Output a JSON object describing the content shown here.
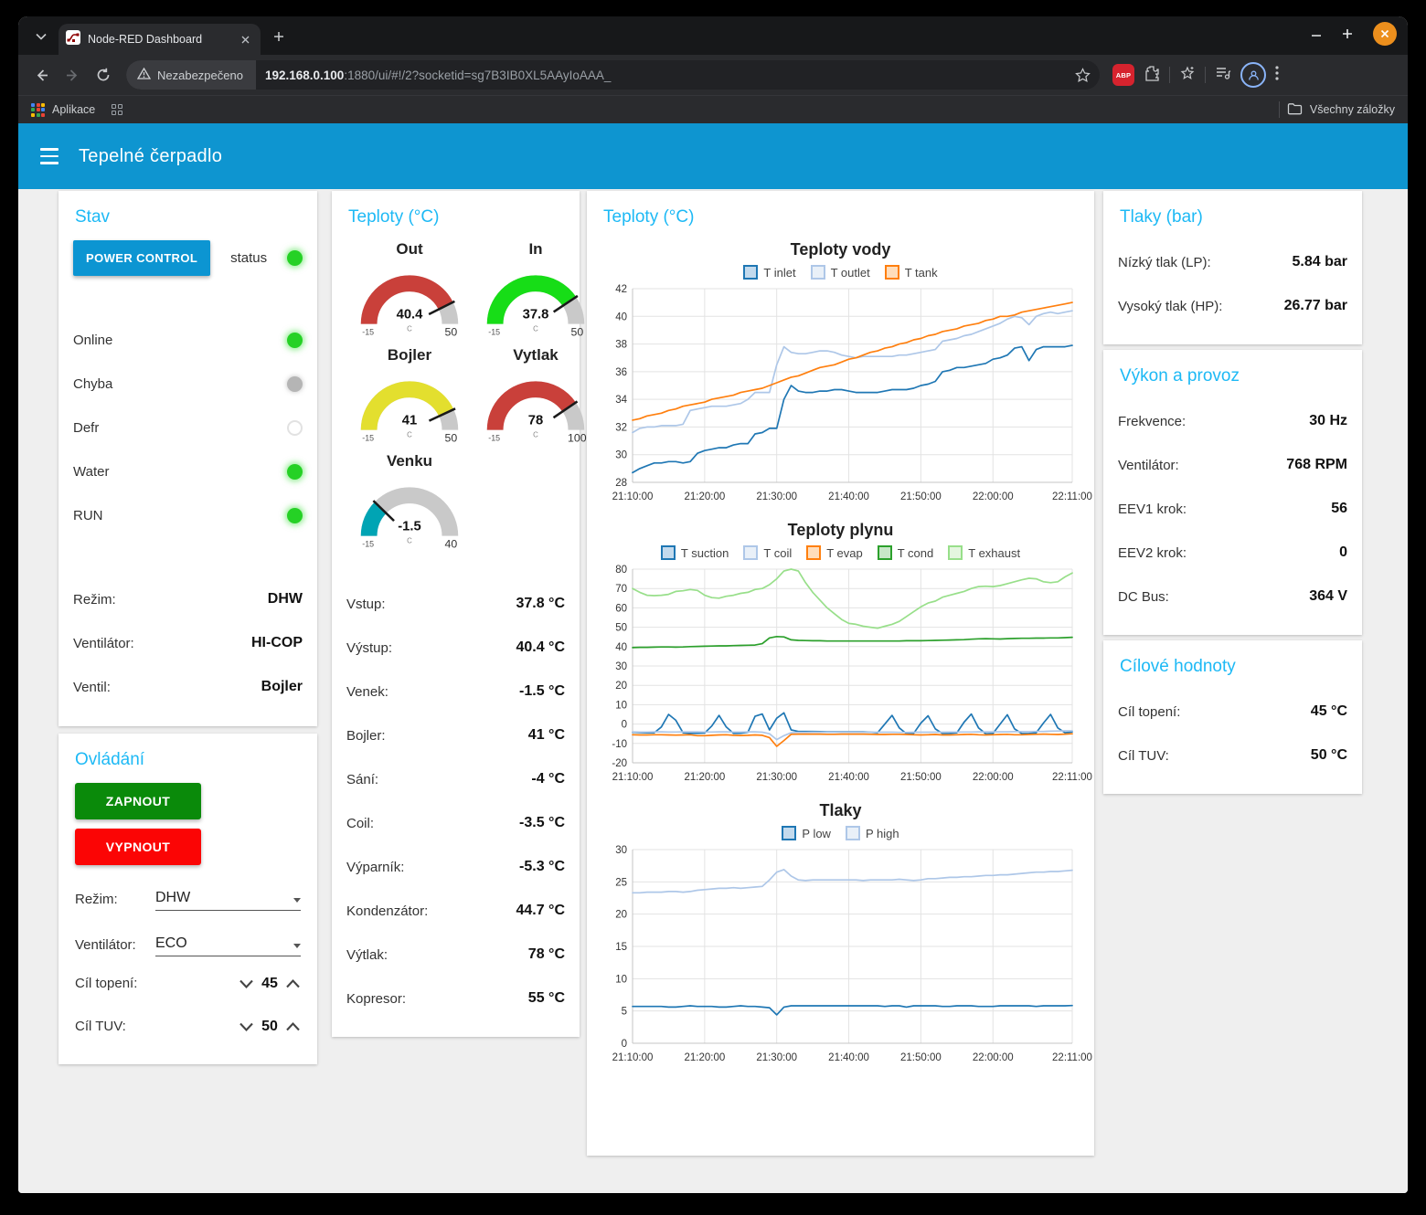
{
  "browser": {
    "tab_title": "Node-RED Dashboard",
    "security_label": "Nezabezpečeno",
    "url_host": "192.168.0.100",
    "url_rest": ":1880/ui/#!/2?socketid=sg7B3IB0XL5AAyIoAAA_",
    "abp_label": "ABP",
    "bookmarks_left": "Aplikace",
    "bookmarks_right": "Všechny záložky"
  },
  "header": {
    "title": "Tepelné čerpadlo"
  },
  "stav": {
    "title": "Stav",
    "power_button": "POWER CONTROL",
    "status_label": "status",
    "leds": [
      {
        "label": "Online",
        "state": "on"
      },
      {
        "label": "Chyba",
        "state": "gray"
      },
      {
        "label": "Defr",
        "state": "off"
      },
      {
        "label": "Water",
        "state": "on"
      },
      {
        "label": "RUN",
        "state": "on"
      }
    ],
    "info": [
      {
        "label": "Režim:",
        "value": "DHW"
      },
      {
        "label": "Ventilátor:",
        "value": "HI-COP"
      },
      {
        "label": "Ventil:",
        "value": "Bojler"
      }
    ]
  },
  "ovladani": {
    "title": "Ovládání",
    "on_button": "ZAPNOUT",
    "off_button": "VYPNOUT",
    "selects": [
      {
        "label": "Režim:",
        "value": "DHW"
      },
      {
        "label": "Ventilátor:",
        "value": "ECO"
      }
    ],
    "steppers": [
      {
        "label": "Cíl topení:",
        "value": "45"
      },
      {
        "label": "Cíl TUV:",
        "value": "50"
      }
    ]
  },
  "teploty": {
    "title": "Teploty (°C)",
    "gauges": [
      {
        "label": "Out",
        "value": "40.4",
        "num": 40.4,
        "min": -15,
        "max": 50,
        "unit": "C",
        "color": "#c9403a"
      },
      {
        "label": "In",
        "value": "37.8",
        "num": 37.8,
        "min": -15,
        "max": 50,
        "unit": "C",
        "color": "#17dd17"
      },
      {
        "label": "Bojler",
        "value": "41",
        "num": 41,
        "min": -15,
        "max": 50,
        "unit": "C",
        "color": "#e3df2e"
      },
      {
        "label": "Vytlak",
        "value": "78",
        "num": 78,
        "min": -15,
        "max": 100,
        "unit": "C",
        "color": "#c9403a"
      },
      {
        "label": "Venku",
        "value": "-1.5",
        "num": -1.5,
        "min": -15,
        "max": 40,
        "unit": "C",
        "color": "#00a4b4"
      }
    ],
    "values": [
      {
        "label": "Vstup:",
        "value": "37.8 °C"
      },
      {
        "label": "Výstup:",
        "value": "40.4 °C"
      },
      {
        "label": "Venek:",
        "value": "-1.5 °C"
      },
      {
        "label": "Bojler:",
        "value": "41 °C"
      },
      {
        "label": "Sání:",
        "value": "-4 °C"
      },
      {
        "label": "Coil:",
        "value": "-3.5 °C"
      },
      {
        "label": "Výparník:",
        "value": "-5.3 °C"
      },
      {
        "label": "Kondenzátor:",
        "value": "44.7 °C"
      },
      {
        "label": "Výtlak:",
        "value": "78 °C"
      },
      {
        "label": "Kopresor:",
        "value": "55 °C"
      }
    ]
  },
  "charts_card": {
    "title": "Teploty (°C)"
  },
  "chart_data": [
    {
      "type": "line",
      "title": "Teploty vody",
      "ylim": [
        28,
        42
      ],
      "y_step": 2,
      "x_total": 61,
      "x_ticks": [
        {
          "m": 0,
          "label": "21:10:00"
        },
        {
          "m": 10,
          "label": "21:20:00"
        },
        {
          "m": 20,
          "label": "21:30:00"
        },
        {
          "m": 30,
          "label": "21:40:00"
        },
        {
          "m": 40,
          "label": "21:50:00"
        },
        {
          "m": 50,
          "label": "22:00:00"
        },
        {
          "m": 61,
          "label": "22:11:00"
        }
      ],
      "series": [
        {
          "name": "T inlet",
          "color": "#1f77b4",
          "fill": "#c3daed",
          "values": [
            28.7,
            29.0,
            29.2,
            29.4,
            29.4,
            29.5,
            29.5,
            29.4,
            29.5,
            30.1,
            30.3,
            30.4,
            30.5,
            30.5,
            30.7,
            30.8,
            30.8,
            31.5,
            31.6,
            31.9,
            31.9,
            34.0,
            35.0,
            34.6,
            34.5,
            34.5,
            34.6,
            34.6,
            34.7,
            34.7,
            34.6,
            34.5,
            34.5,
            34.5,
            34.5,
            34.6,
            34.7,
            34.7,
            34.7,
            34.8,
            35.0,
            35.1,
            35.3,
            36.0,
            36.1,
            36.3,
            36.3,
            36.4,
            36.5,
            36.6,
            36.9,
            37.0,
            37.2,
            37.7,
            37.8,
            36.8,
            37.6,
            37.8,
            37.8,
            37.8,
            37.8,
            37.9
          ]
        },
        {
          "name": "T outlet",
          "color": "#aec7e8",
          "fill": "#e9f0f8",
          "values": [
            31.6,
            31.9,
            32.0,
            32.0,
            32.1,
            32.1,
            32.1,
            32.2,
            33.2,
            33.3,
            33.4,
            33.5,
            33.5,
            33.5,
            33.6,
            33.7,
            34.0,
            34.5,
            34.5,
            34.5,
            36.5,
            37.8,
            37.4,
            37.3,
            37.3,
            37.4,
            37.5,
            37.5,
            37.4,
            37.2,
            37.1,
            37.0,
            37.1,
            37.1,
            37.1,
            37.1,
            37.1,
            37.2,
            37.2,
            37.3,
            37.4,
            37.5,
            37.6,
            38.2,
            38.3,
            38.4,
            38.6,
            38.7,
            38.9,
            39.1,
            39.3,
            39.5,
            39.8,
            40.0,
            39.9,
            39.4,
            40.0,
            40.2,
            40.3,
            40.2,
            40.3,
            40.4
          ]
        },
        {
          "name": "T tank",
          "color": "#ff7f0e",
          "fill": "#ffddbb",
          "values": [
            32.5,
            32.6,
            32.8,
            32.9,
            33.0,
            33.2,
            33.3,
            33.5,
            33.6,
            33.7,
            33.8,
            34.0,
            34.1,
            34.2,
            34.3,
            34.5,
            34.6,
            34.7,
            34.8,
            35.0,
            35.2,
            35.4,
            35.6,
            35.7,
            35.9,
            36.1,
            36.3,
            36.4,
            36.5,
            36.7,
            36.9,
            37.0,
            37.2,
            37.4,
            37.5,
            37.7,
            37.8,
            38.0,
            38.1,
            38.3,
            38.4,
            38.6,
            38.7,
            38.9,
            39.0,
            39.1,
            39.3,
            39.4,
            39.5,
            39.7,
            39.8,
            40.0,
            40.0,
            40.1,
            40.3,
            40.4,
            40.5,
            40.6,
            40.7,
            40.8,
            40.9,
            41.0
          ]
        }
      ]
    },
    {
      "type": "line",
      "title": "Teploty plynu",
      "ylim": [
        -20,
        80
      ],
      "y_step": 10,
      "x_total": 61,
      "x_ticks": [
        {
          "m": 0,
          "label": "21:10:00"
        },
        {
          "m": 10,
          "label": "21:20:00"
        },
        {
          "m": 20,
          "label": "21:30:00"
        },
        {
          "m": 30,
          "label": "21:40:00"
        },
        {
          "m": 40,
          "label": "21:50:00"
        },
        {
          "m": 50,
          "label": "22:00:00"
        },
        {
          "m": 61,
          "label": "22:11:00"
        }
      ],
      "series": [
        {
          "name": "T suction",
          "color": "#1f77b4",
          "fill": "#c3daed",
          "values": [
            -4.2,
            -4.4,
            -4.5,
            -4.5,
            -1.5,
            5.0,
            2.0,
            -4.5,
            -4.8,
            -4.7,
            -4.6,
            -1.0,
            4.5,
            -1.5,
            -4.8,
            -4.7,
            -4.2,
            4.0,
            5.2,
            -3.0,
            3.0,
            5.8,
            -3.0,
            -3.8,
            -3.8,
            -3.8,
            -3.9,
            -4.0,
            -4.0,
            -4.0,
            -4.0,
            -4.0,
            -4.0,
            -4.2,
            -4.5,
            0.0,
            4.5,
            -2.0,
            -5.0,
            -4.8,
            0.5,
            4.3,
            -2.5,
            -4.9,
            -4.8,
            -4.5,
            1.0,
            5.2,
            -2.0,
            -5.0,
            -4.8,
            0.0,
            4.8,
            -2.5,
            -4.9,
            -4.8,
            -4.5,
            0.5,
            5.0,
            -2.0,
            -4.5,
            -4.0
          ]
        },
        {
          "name": "T coil",
          "color": "#aec7e8",
          "fill": "#e9f0f8",
          "values": [
            -4.0,
            -4.1,
            -4.1,
            -4.0,
            -4.0,
            -4.1,
            -4.1,
            -4.0,
            -4.0,
            -4.0,
            -4.1,
            -4.1,
            -4.0,
            -4.0,
            -4.1,
            -4.1,
            -4.0,
            -4.0,
            -4.2,
            -5.0,
            -8.0,
            -6.0,
            -4.5,
            -4.3,
            -4.3,
            -4.2,
            -4.2,
            -4.2,
            -4.2,
            -4.2,
            -4.2,
            -4.2,
            -4.2,
            -4.2,
            -4.2,
            -4.2,
            -4.2,
            -4.3,
            -4.3,
            -4.2,
            -4.2,
            -4.2,
            -4.2,
            -4.2,
            -4.1,
            -4.1,
            -4.1,
            -4.1,
            -4.0,
            -4.0,
            -4.0,
            -4.0,
            -4.0,
            -3.9,
            -3.9,
            -3.9,
            -3.8,
            -3.8,
            -3.7,
            -3.6,
            -3.5,
            -3.5
          ]
        },
        {
          "name": "T evap",
          "color": "#ff7f0e",
          "fill": "#ffddbb",
          "values": [
            -5.5,
            -5.6,
            -5.6,
            -5.5,
            -5.5,
            -5.6,
            -5.7,
            -5.6,
            -5.5,
            -6.0,
            -6.0,
            -5.8,
            -5.6,
            -5.5,
            -5.8,
            -5.9,
            -5.8,
            -5.6,
            -5.8,
            -7.0,
            -11.5,
            -8.5,
            -5.3,
            -5.2,
            -5.2,
            -5.2,
            -5.2,
            -5.3,
            -5.3,
            -5.2,
            -5.2,
            -5.2,
            -5.2,
            -5.3,
            -5.4,
            -5.4,
            -5.3,
            -5.3,
            -5.4,
            -5.5,
            -5.6,
            -5.5,
            -5.4,
            -5.6,
            -5.6,
            -5.5,
            -5.4,
            -5.3,
            -5.5,
            -5.6,
            -5.5,
            -5.4,
            -5.3,
            -5.5,
            -5.5,
            -5.4,
            -5.3,
            -5.2,
            -5.3,
            -5.4,
            -5.2,
            -5.0
          ]
        },
        {
          "name": "T cond",
          "color": "#2ca02c",
          "fill": "#c8e7c8",
          "values": [
            39.5,
            39.6,
            39.6,
            39.7,
            39.8,
            39.8,
            39.7,
            39.8,
            40.0,
            40.1,
            40.2,
            40.3,
            40.4,
            40.4,
            40.5,
            40.6,
            40.7,
            40.8,
            41.5,
            44.5,
            45.2,
            45.0,
            43.5,
            43.2,
            43.1,
            43.0,
            43.0,
            42.9,
            42.9,
            42.9,
            42.9,
            42.9,
            42.9,
            42.9,
            42.9,
            42.9,
            42.9,
            42.9,
            43.0,
            43.0,
            43.0,
            43.1,
            43.2,
            43.3,
            43.4,
            43.5,
            43.6,
            43.8,
            44.0,
            44.1,
            44.0,
            43.9,
            44.1,
            44.2,
            44.3,
            44.3,
            44.4,
            44.4,
            44.5,
            44.5,
            44.6,
            44.8
          ]
        },
        {
          "name": "T exhaust",
          "color": "#98df8a",
          "fill": "#e4f6df",
          "values": [
            70,
            68,
            66.5,
            66.3,
            66.5,
            67,
            68.5,
            68.8,
            69.5,
            69,
            66.5,
            65.3,
            65,
            66,
            66.5,
            67.5,
            68,
            69.5,
            70,
            72,
            75,
            79,
            80,
            79,
            73,
            68,
            64,
            60,
            57,
            54,
            52,
            51.5,
            50.5,
            50,
            49.5,
            50.5,
            51.5,
            53,
            55.5,
            58,
            60.5,
            62.5,
            63.5,
            65.5,
            66.5,
            67.5,
            68.5,
            70,
            71,
            71.2,
            71,
            71.5,
            72.5,
            73.5,
            74.5,
            75.3,
            75,
            73.5,
            73,
            73.5,
            76,
            78
          ]
        }
      ]
    },
    {
      "type": "line",
      "title": "Tlaky",
      "ylim": [
        0,
        30
      ],
      "y_step": 5,
      "x_total": 61,
      "x_ticks": [
        {
          "m": 0,
          "label": "21:10:00"
        },
        {
          "m": 10,
          "label": "21:20:00"
        },
        {
          "m": 20,
          "label": "21:30:00"
        },
        {
          "m": 30,
          "label": "21:40:00"
        },
        {
          "m": 40,
          "label": "21:50:00"
        },
        {
          "m": 50,
          "label": "22:00:00"
        },
        {
          "m": 61,
          "label": "22:11:00"
        }
      ],
      "series": [
        {
          "name": "P low",
          "color": "#1f77b4",
          "fill": "#c3daed",
          "values": [
            5.7,
            5.7,
            5.7,
            5.7,
            5.7,
            5.6,
            5.6,
            5.7,
            5.8,
            5.7,
            5.7,
            5.7,
            5.6,
            5.6,
            5.7,
            5.8,
            5.7,
            5.7,
            5.6,
            5.5,
            4.4,
            5.6,
            5.8,
            5.8,
            5.8,
            5.8,
            5.8,
            5.8,
            5.8,
            5.8,
            5.8,
            5.8,
            5.8,
            5.8,
            5.8,
            5.7,
            5.8,
            5.8,
            5.6,
            5.8,
            5.8,
            5.8,
            5.8,
            5.7,
            5.7,
            5.8,
            5.8,
            5.8,
            5.7,
            5.7,
            5.7,
            5.8,
            5.8,
            5.8,
            5.8,
            5.8,
            5.7,
            5.8,
            5.8,
            5.8,
            5.8,
            5.84
          ]
        },
        {
          "name": "P high",
          "color": "#aec7e8",
          "fill": "#e9f0f8",
          "values": [
            23.3,
            23.3,
            23.4,
            23.4,
            23.4,
            23.5,
            23.5,
            23.4,
            23.5,
            23.7,
            23.8,
            23.9,
            24.0,
            24.0,
            24.1,
            24.0,
            24.1,
            24.2,
            24.3,
            25.3,
            26.5,
            26.9,
            25.9,
            25.3,
            25.2,
            25.3,
            25.3,
            25.3,
            25.3,
            25.3,
            25.3,
            25.3,
            25.2,
            25.3,
            25.3,
            25.3,
            25.3,
            25.4,
            25.3,
            25.2,
            25.3,
            25.5,
            25.5,
            25.6,
            25.7,
            25.7,
            25.8,
            25.8,
            25.9,
            26.0,
            26.0,
            26.1,
            26.1,
            26.2,
            26.3,
            26.4,
            26.5,
            26.5,
            26.6,
            26.6,
            26.7,
            26.8
          ]
        }
      ]
    }
  ],
  "tlaky": {
    "title": "Tlaky (bar)",
    "rows": [
      {
        "label": "Nízký tlak (LP):",
        "value": "5.84 bar"
      },
      {
        "label": "Vysoký tlak (HP):",
        "value": "26.77 bar"
      }
    ]
  },
  "vykon": {
    "title": "Výkon a provoz",
    "rows": [
      {
        "label": "Frekvence:",
        "value": "30 Hz"
      },
      {
        "label": "Ventilátor:",
        "value": "768 RPM"
      },
      {
        "label": "EEV1 krok:",
        "value": "56"
      },
      {
        "label": "EEV2 krok:",
        "value": "0"
      },
      {
        "label": "DC Bus:",
        "value": "364 V"
      }
    ]
  },
  "cilove": {
    "title": "Cílové hodnoty",
    "rows": [
      {
        "label": "Cíl topení:",
        "value": "45 °C"
      },
      {
        "label": "Cíl TUV:",
        "value": "50 °C"
      }
    ]
  }
}
